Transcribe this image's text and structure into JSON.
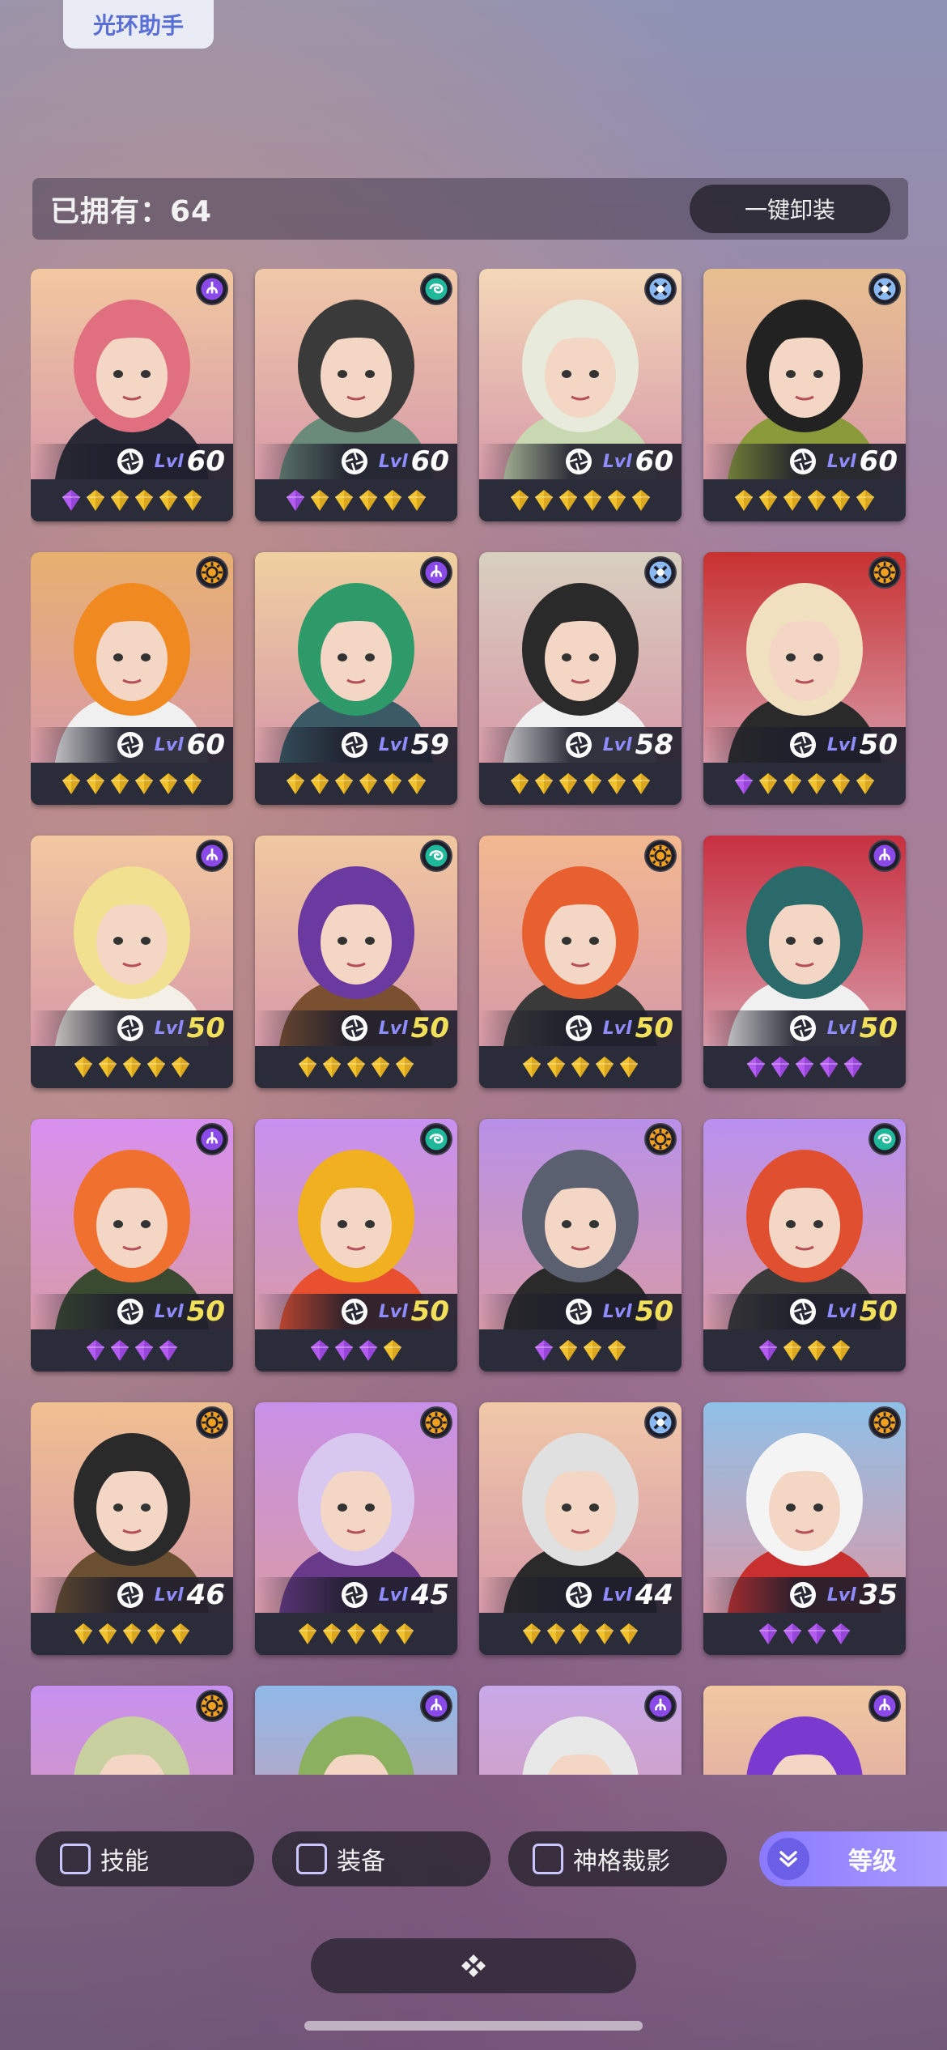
{
  "app_tag": "光环助手",
  "owned_label": "已拥有：64",
  "unequip_all_label": "一键卸装",
  "level_prefix": "Lvl",
  "heroes": [
    {
      "level": "60",
      "element": "void",
      "gems": [
        "purple",
        "gold",
        "gold",
        "gold",
        "gold",
        "gold"
      ],
      "palette": [
        "#f2c8a0",
        "#e07080",
        "#2a2a36"
      ]
    },
    {
      "level": "60",
      "element": "wind",
      "gems": [
        "purple",
        "gold",
        "gold",
        "gold",
        "gold",
        "gold"
      ],
      "palette": [
        "#f0c8a8",
        "#3a3a3a",
        "#6a8a7a"
      ]
    },
    {
      "level": "60",
      "element": "cross",
      "gems": [
        "gold",
        "gold",
        "gold",
        "gold",
        "gold",
        "gold"
      ],
      "palette": [
        "#f4d8b8",
        "#e8eadc",
        "#c8d8b0"
      ]
    },
    {
      "level": "60",
      "element": "cross",
      "gems": [
        "gold",
        "gold",
        "gold",
        "gold",
        "gold",
        "gold"
      ],
      "palette": [
        "#e8c090",
        "#222222",
        "#8a9a3a"
      ]
    },
    {
      "level": "60",
      "element": "sun",
      "gems": [
        "gold",
        "gold",
        "gold",
        "gold",
        "gold",
        "gold"
      ],
      "palette": [
        "#e8b070",
        "#f08a20",
        "#f0f0f0"
      ]
    },
    {
      "level": "59",
      "element": "void",
      "gems": [
        "gold",
        "gold",
        "gold",
        "gold",
        "gold",
        "gold"
      ],
      "palette": [
        "#f0d0a0",
        "#2e9a6a",
        "#3a5a66"
      ]
    },
    {
      "level": "58",
      "element": "cross",
      "gems": [
        "gold",
        "gold",
        "gold",
        "gold",
        "gold",
        "gold"
      ],
      "palette": [
        "#d8d0c0",
        "#2a2a2a",
        "#f0f0f0"
      ]
    },
    {
      "level": "50",
      "element": "sun",
      "gems": [
        "purple",
        "gold",
        "gold",
        "gold",
        "gold",
        "gold"
      ],
      "palette": [
        "#c83030",
        "#f0e0c0",
        "#2a2a2a"
      ]
    },
    {
      "level": "50",
      "element": "void",
      "gems": [
        "gold",
        "gold",
        "gold",
        "gold",
        "gold"
      ],
      "palette": [
        "#f2c8a0",
        "#f0e090",
        "#f4f0e8"
      ],
      "gold_level": true
    },
    {
      "level": "50",
      "element": "wind",
      "gems": [
        "gold",
        "gold",
        "gold",
        "gold",
        "gold"
      ],
      "palette": [
        "#f0c8a0",
        "#6a3aa0",
        "#7a5030"
      ],
      "gold_level": true
    },
    {
      "level": "50",
      "element": "sun",
      "gems": [
        "gold",
        "gold",
        "gold",
        "gold",
        "gold"
      ],
      "palette": [
        "#f2b890",
        "#e86030",
        "#3a3a3a"
      ],
      "gold_level": true
    },
    {
      "level": "50",
      "element": "void",
      "gems": [
        "purple",
        "purple",
        "purple",
        "purple",
        "purple"
      ],
      "palette": [
        "#c83040",
        "#2a6a6a",
        "#f0f0f0"
      ],
      "gold_level": true
    },
    {
      "level": "50",
      "element": "void",
      "gems": [
        "purple",
        "purple",
        "purple",
        "purple"
      ],
      "palette": [
        "#d890f0",
        "#f07030",
        "#3a4a30"
      ],
      "gold_level": true
    },
    {
      "level": "50",
      "element": "wind",
      "gems": [
        "purple",
        "purple",
        "purple",
        "gold"
      ],
      "palette": [
        "#c890f0",
        "#f0b020",
        "#e85030"
      ],
      "gold_level": true
    },
    {
      "level": "50",
      "element": "sun",
      "gems": [
        "purple",
        "gold",
        "gold",
        "gold"
      ],
      "palette": [
        "#b890e8",
        "#5a6070",
        "#2a2a2a"
      ],
      "gold_level": true
    },
    {
      "level": "50",
      "element": "wind",
      "gems": [
        "purple",
        "gold",
        "gold",
        "gold"
      ],
      "palette": [
        "#b890f0",
        "#e05030",
        "#3a3a3a"
      ],
      "gold_level": true
    },
    {
      "level": "46",
      "element": "sun",
      "gems": [
        "gold",
        "gold",
        "gold",
        "gold",
        "gold"
      ],
      "palette": [
        "#f0c090",
        "#2a2a2a",
        "#6a5030"
      ]
    },
    {
      "level": "45",
      "element": "sun",
      "gems": [
        "gold",
        "gold",
        "gold",
        "gold",
        "gold"
      ],
      "palette": [
        "#c890e8",
        "#d8c8f0",
        "#6a3a8a"
      ]
    },
    {
      "level": "44",
      "element": "cross",
      "gems": [
        "gold",
        "gold",
        "gold",
        "gold",
        "gold"
      ],
      "palette": [
        "#f0c8a8",
        "#e0e0e0",
        "#2a2a2a"
      ]
    },
    {
      "level": "35",
      "element": "sun",
      "gems": [
        "purple",
        "purple",
        "purple",
        "purple"
      ],
      "palette": [
        "#90c0e8",
        "#f4f4f4",
        "#c83030"
      ]
    },
    {
      "level": "",
      "element": "sun",
      "gems": [],
      "palette": [
        "#c890f0",
        "#c8d0a0",
        "#f0f0f0"
      ]
    },
    {
      "level": "",
      "element": "void",
      "gems": [],
      "palette": [
        "#90b8e8",
        "#8ab060",
        "#6a3a8a"
      ]
    },
    {
      "level": "",
      "element": "void",
      "gems": [],
      "palette": [
        "#c8a8e8",
        "#e8e8e8",
        "#c0c0c0"
      ]
    },
    {
      "level": "",
      "element": "void",
      "gems": [],
      "palette": [
        "#f0c8a0",
        "#7a3ad0",
        "#3a3a3a"
      ]
    }
  ],
  "filters": {
    "skill": "技能",
    "equipment": "装备",
    "divine": "神格裁影",
    "sort": "等级"
  },
  "colors": {
    "accent": "#8a7aff",
    "level_gold": "#f3e05a",
    "gem_gold": "#f2c12e",
    "gem_purple": "#b45cf2"
  }
}
